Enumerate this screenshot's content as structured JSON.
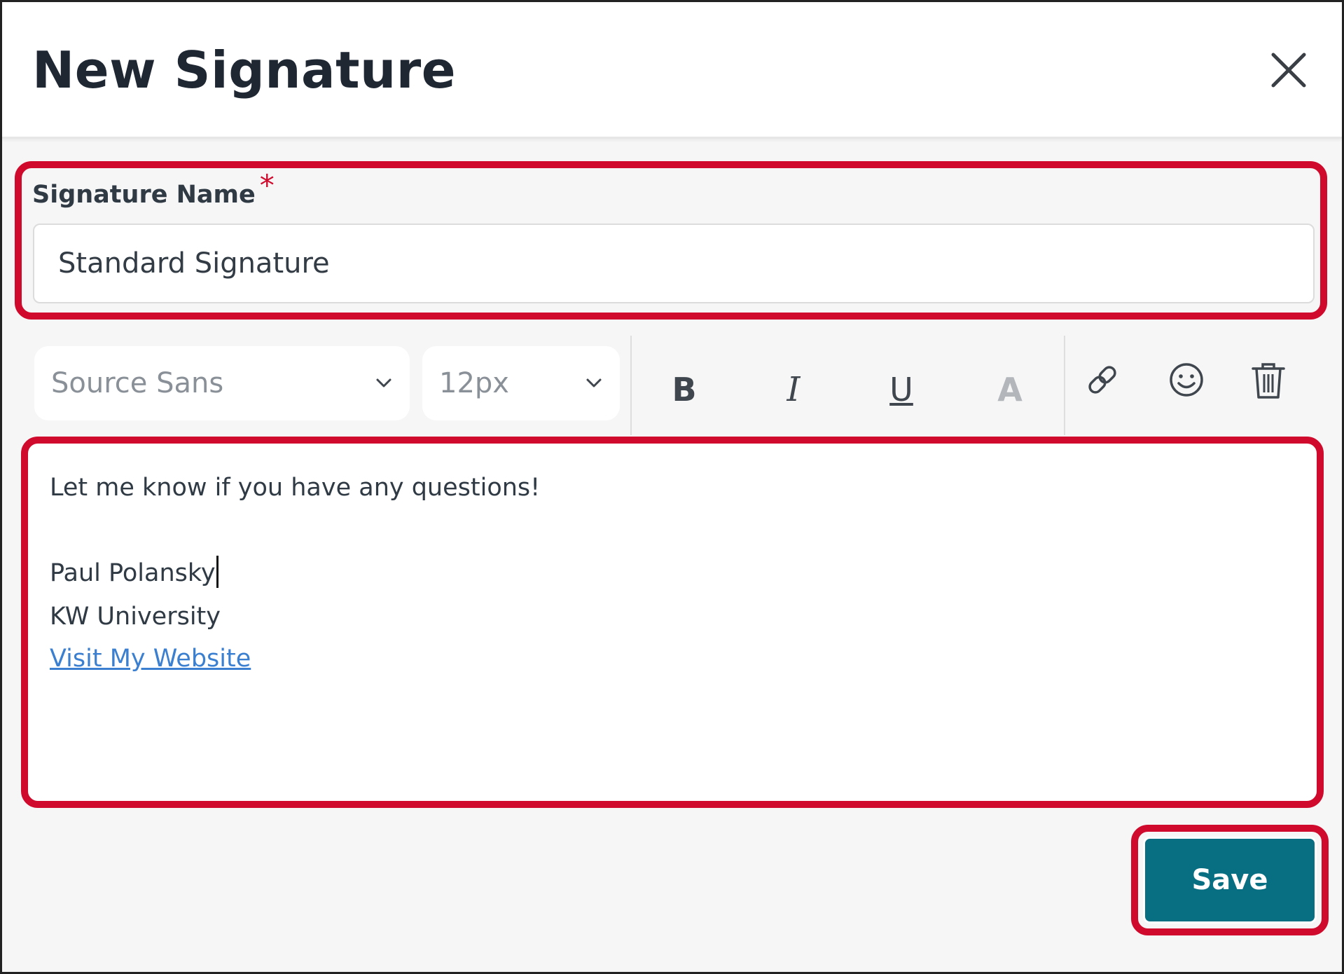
{
  "dialog": {
    "title": "New Signature",
    "close_icon": "close-icon"
  },
  "signature_name": {
    "label": "Signature Name",
    "required_marker": "*",
    "value": "Standard Signature"
  },
  "toolbar": {
    "font_family": "Source Sans",
    "font_size": "12px",
    "bold_label": "B",
    "italic_label": "I",
    "underline_label": "U",
    "text_color_label": "A",
    "icons": [
      "chevron-down-icon",
      "link-icon",
      "emoji-icon",
      "trash-icon"
    ]
  },
  "editor": {
    "lines": [
      "Let me know if you have any questions!",
      "Paul Polansky",
      "KW University"
    ],
    "link_text": "Visit My Website"
  },
  "actions": {
    "save_label": "Save"
  },
  "colors": {
    "highlight": "#cf0a2c",
    "save_button": "#086e82",
    "link": "#3b7fd1",
    "title_text": "#1f2733"
  }
}
